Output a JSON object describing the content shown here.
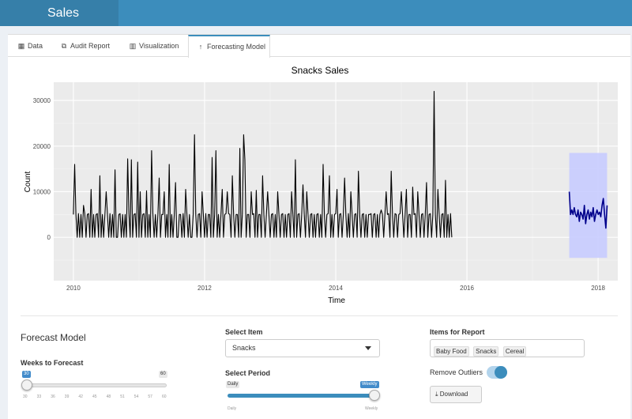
{
  "app": {
    "title": "Sales"
  },
  "tabs": [
    {
      "label": "Data",
      "icon": "table-icon"
    },
    {
      "label": "Audit Report",
      "icon": "copy-icon"
    },
    {
      "label": "Visualization",
      "icon": "bar-chart-icon"
    },
    {
      "label": "Forecasting Model",
      "icon": "arrow-up-icon",
      "active": true
    }
  ],
  "controls": {
    "forecast_model_heading": "Forecast Model",
    "weeks_label": "Weeks to Forecast",
    "weeks_value": "30",
    "weeks_max": "60",
    "weeks_ticks": [
      "30",
      "33",
      "36",
      "39",
      "42",
      "45",
      "48",
      "51",
      "54",
      "57",
      "60"
    ],
    "weeks_level": 0,
    "select_item_label": "Select Item",
    "select_item_value": "Snacks",
    "select_period_label": "Select Period",
    "period_left": "Daily",
    "period_right": "Weekly",
    "period_value": "Weekly",
    "items_report_label": "Items for Report",
    "items_report": [
      "Baby Food",
      "Snacks",
      "Cereal"
    ],
    "remove_outliers_label": "Remove Outliers",
    "remove_outliers_on": true,
    "download_label": "Download",
    "accent": "#3c8dbc"
  },
  "chart_data": {
    "type": "line",
    "title": "Snacks Sales",
    "xlabel": "Time",
    "ylabel": "Count",
    "xlim": [
      2009.7,
      2018.3
    ],
    "ylim": [
      -9500,
      34000
    ],
    "x_ticks": [
      "2010",
      "2012",
      "2014",
      "2016",
      "2018"
    ],
    "y_ticks": [
      "0",
      "10000",
      "20000",
      "30000"
    ],
    "grid": true,
    "series": [
      {
        "role": "history",
        "color": "#000000",
        "x_start": 2010.0,
        "x_step": 0.01923,
        "values": [
          5000,
          16000,
          5000,
          0,
          5200,
          0,
          5000,
          0,
          7000,
          5200,
          0,
          5000,
          5200,
          0,
          10500,
          0,
          5000,
          0,
          5000,
          5200,
          0,
          13500,
          0,
          5000,
          0,
          5000,
          10000,
          5000,
          0,
          5200,
          0,
          5000,
          0,
          14800,
          0,
          0,
          5000,
          5200,
          0,
          5000,
          0,
          5000,
          0,
          17200,
          5200,
          0,
          17000,
          0,
          5000,
          5200,
          0,
          16500,
          0,
          10000,
          0,
          5000,
          5200,
          0,
          10200,
          0,
          5000,
          0,
          19000,
          5200,
          0,
          5000,
          0,
          5000,
          13000,
          0,
          5000,
          5000,
          10000,
          0,
          5000,
          0,
          16000,
          0,
          5000,
          0,
          5000,
          12000,
          0,
          0,
          5000,
          5000,
          0,
          5200,
          0,
          10500,
          5000,
          0,
          5000,
          0,
          0,
          5200,
          22500,
          5000,
          0,
          5000,
          5200,
          0,
          10000,
          5000,
          0,
          5200,
          0,
          5000,
          5000,
          0,
          17500,
          0,
          5000,
          19000,
          0,
          5000,
          0,
          5000,
          10500,
          0,
          5000,
          5200,
          10000,
          5200,
          5000,
          0,
          13500,
          5000,
          0,
          5000,
          5000,
          0,
          19500,
          0,
          5200,
          22500,
          17000,
          0,
          5000,
          5000,
          0,
          10000,
          5000,
          5200,
          0,
          10300,
          0,
          5000,
          5000,
          0,
          13500,
          5000,
          0,
          5000,
          10000,
          5000,
          0,
          5000,
          5200,
          0,
          5000,
          0,
          10000,
          5000,
          0,
          5000,
          5200,
          0,
          5000,
          0,
          5000,
          5200,
          0,
          10000,
          5000,
          0,
          17000,
          0,
          5000,
          5200,
          0,
          5000,
          11500,
          5200,
          0,
          10000,
          5000,
          0,
          5000,
          5200,
          0,
          5000,
          0,
          5000,
          5200,
          0,
          5000,
          0,
          16000,
          5000,
          0,
          5000,
          5200,
          13500,
          0,
          5000,
          0,
          5000,
          5200,
          10500,
          0,
          5000,
          5200,
          0,
          5000,
          13000,
          5000,
          0,
          5200,
          0,
          10000,
          5000,
          0,
          5000,
          5200,
          0,
          14500,
          5000,
          0,
          5000,
          5200,
          0,
          5000,
          0,
          5000,
          5000,
          5200,
          0,
          5000,
          5200,
          0,
          5000,
          0,
          5000,
          6000,
          5000,
          0,
          5200,
          10000,
          5000,
          5200,
          0,
          14500,
          5000,
          0,
          5200,
          5000,
          0,
          5000,
          5200,
          10000,
          5000,
          0,
          5000,
          10500,
          0,
          5000,
          5000,
          0,
          11000,
          5000,
          5200,
          0,
          10000,
          5000,
          0,
          5000,
          5200,
          0,
          5000,
          12000,
          0,
          5000,
          5200,
          0,
          5000,
          32000,
          5000,
          0,
          10500,
          5000,
          0,
          5000,
          5200,
          0,
          12500,
          0,
          5000,
          0,
          5200,
          0
        ]
      },
      {
        "role": "forecast",
        "color": "#00008b",
        "x_start": 2017.56,
        "x_step": 0.01923,
        "values": [
          10000,
          5000,
          6000,
          5000,
          6500,
          5000,
          4500,
          6000,
          3500,
          5500,
          5000,
          4000,
          7000,
          3000,
          5000,
          6000,
          4000,
          5500,
          4500,
          6500,
          3500,
          5000,
          6000,
          5000,
          5500,
          4500,
          7000,
          8500,
          5000,
          2000,
          7000
        ],
        "band_lo": -4500,
        "band_hi": 18500,
        "band_color": "#c8ccff"
      }
    ]
  }
}
